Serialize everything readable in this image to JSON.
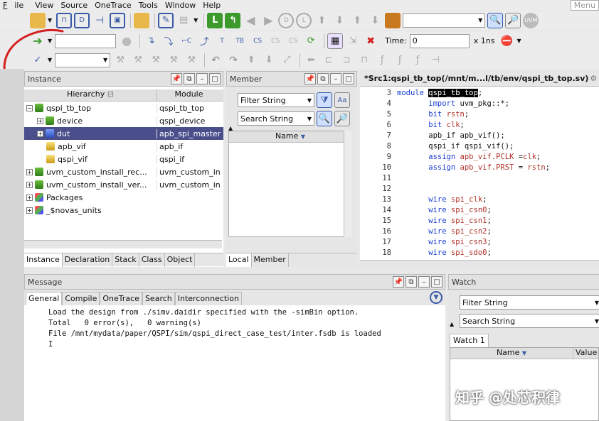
{
  "menu": [
    "File",
    "View",
    "Source",
    "OneTrace",
    "Tools",
    "Window",
    "Help",
    "Menu"
  ],
  "toolbar2": {
    "time_label": "Time:",
    "time_value": "0",
    "time_unit": "x 1ns"
  },
  "instance_panel": {
    "title": "Instance",
    "col_hierarchy": "Hierarchy",
    "col_module": "Module",
    "rows": [
      {
        "name": "qspi_tb_top",
        "module": "qspi_tb_top"
      },
      {
        "name": "device",
        "module": "qspi_device"
      },
      {
        "name": "dut",
        "module": "apb_spi_master"
      },
      {
        "name": "apb_vif",
        "module": "apb_if"
      },
      {
        "name": "qspi_vif",
        "module": "qspi_if"
      },
      {
        "name": "uvm_custom_install_rec...",
        "module": "uvm_custom_in"
      },
      {
        "name": "uvm_custom_install_ver...",
        "module": "uvm_custom_in"
      },
      {
        "name": "Packages",
        "module": ""
      },
      {
        "name": "_$novas_units",
        "module": ""
      }
    ],
    "tabs": [
      "Instance",
      "Declaration",
      "Stack",
      "Class",
      "Object"
    ]
  },
  "member_panel": {
    "title": "Member",
    "filter_placeholder": "Filter String",
    "search_placeholder": "Search String",
    "col_name": "Name",
    "tabs": [
      "Local",
      "Member"
    ]
  },
  "source_panel": {
    "title": "*Src1:qspi_tb_top(/mnt/m...l/tb/env/qspi_tb_top.sv)",
    "lines": [
      {
        "n": "3",
        "t": "module qspi_tb_top;"
      },
      {
        "n": "4",
        "t": "import uvm_pkg::*;"
      },
      {
        "n": "5",
        "t": "bit rstn;"
      },
      {
        "n": "6",
        "t": "bit clk;"
      },
      {
        "n": "7",
        "t": "apb_if apb_vif();"
      },
      {
        "n": "8",
        "t": "qspi_if qspi_vif();"
      },
      {
        "n": "9",
        "t": "assign apb_vif.PCLK =clk;"
      },
      {
        "n": "10",
        "t": "assign apb_vif.PRST = rstn;"
      },
      {
        "n": "11",
        "t": ""
      },
      {
        "n": "12",
        "t": ""
      },
      {
        "n": "13",
        "t": "wire spi_clk;"
      },
      {
        "n": "14",
        "t": "wire spi_csn0;"
      },
      {
        "n": "15",
        "t": "wire spi_csn1;"
      },
      {
        "n": "16",
        "t": "wire spi_csn2;"
      },
      {
        "n": "17",
        "t": "wire spi_csn3;"
      },
      {
        "n": "18",
        "t": "wire spi_sdo0;"
      }
    ]
  },
  "message_panel": {
    "title": "Message",
    "tabs": [
      "General",
      "Compile",
      "OneTrace",
      "Search",
      "Interconnection"
    ],
    "lines": [
      "Load the design from ./simv.daidir specified with the -simBin option.",
      "Total   0 error(s),   0 warning(s)",
      "File /mnt/mydata/paper/QSPI/sim/qspi_direct_case_test/inter.fsdb is loaded"
    ]
  },
  "watch_panel": {
    "title": "Watch",
    "filter_placeholder": "Filter String",
    "search_placeholder": "Search String",
    "tab": "Watch 1",
    "col_name": "Name",
    "col_value": "Value"
  },
  "watermark": "知乎 @处芯积律",
  "colors": {
    "selection": "#4a4f8c",
    "keyword": "#1a3fd4",
    "identifier": "#b0322a",
    "annotation": "#d42020"
  }
}
